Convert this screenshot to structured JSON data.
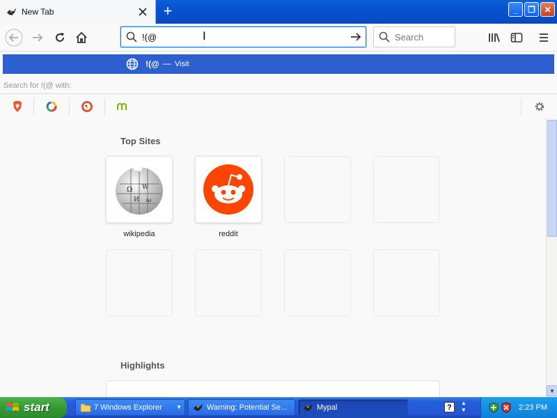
{
  "browser": {
    "tab_title": "New Tab",
    "new_tab_symbol": "+",
    "window_buttons": {
      "minimize": "_",
      "maximize": "❐",
      "close": "✕"
    }
  },
  "toolbar": {
    "url_value": "!(@",
    "search_placeholder": "Search"
  },
  "popup": {
    "suggestion_text": "!(@",
    "suggestion_dash": "—",
    "suggestion_action": "Visit",
    "search_for_label": "Search for !(@ with:",
    "engines": [
      "brave-icon",
      "qwant-icon",
      "duckduckgo-icon",
      "mojeek-icon"
    ]
  },
  "newtab": {
    "top_sites_title": "Top Sites",
    "sites": [
      {
        "label": "wikipedia",
        "icon": "wikipedia-icon"
      },
      {
        "label": "reddit",
        "icon": "reddit-icon"
      }
    ],
    "highlights_title": "Highlights"
  },
  "taskbar": {
    "start_label": "start",
    "items": [
      {
        "label": "7 Windows Explorer",
        "icon": "folder-icon"
      },
      {
        "label": "Warning: Potential Se...",
        "icon": "mypal-icon"
      },
      {
        "label": "Mypal",
        "icon": "mypal-icon"
      }
    ],
    "clock": "2:23 PM"
  },
  "colors": {
    "accent": "#2d5fcf",
    "titlebar": "#0553d0",
    "reddit": "#ff4500",
    "start_green": "#379a35"
  }
}
